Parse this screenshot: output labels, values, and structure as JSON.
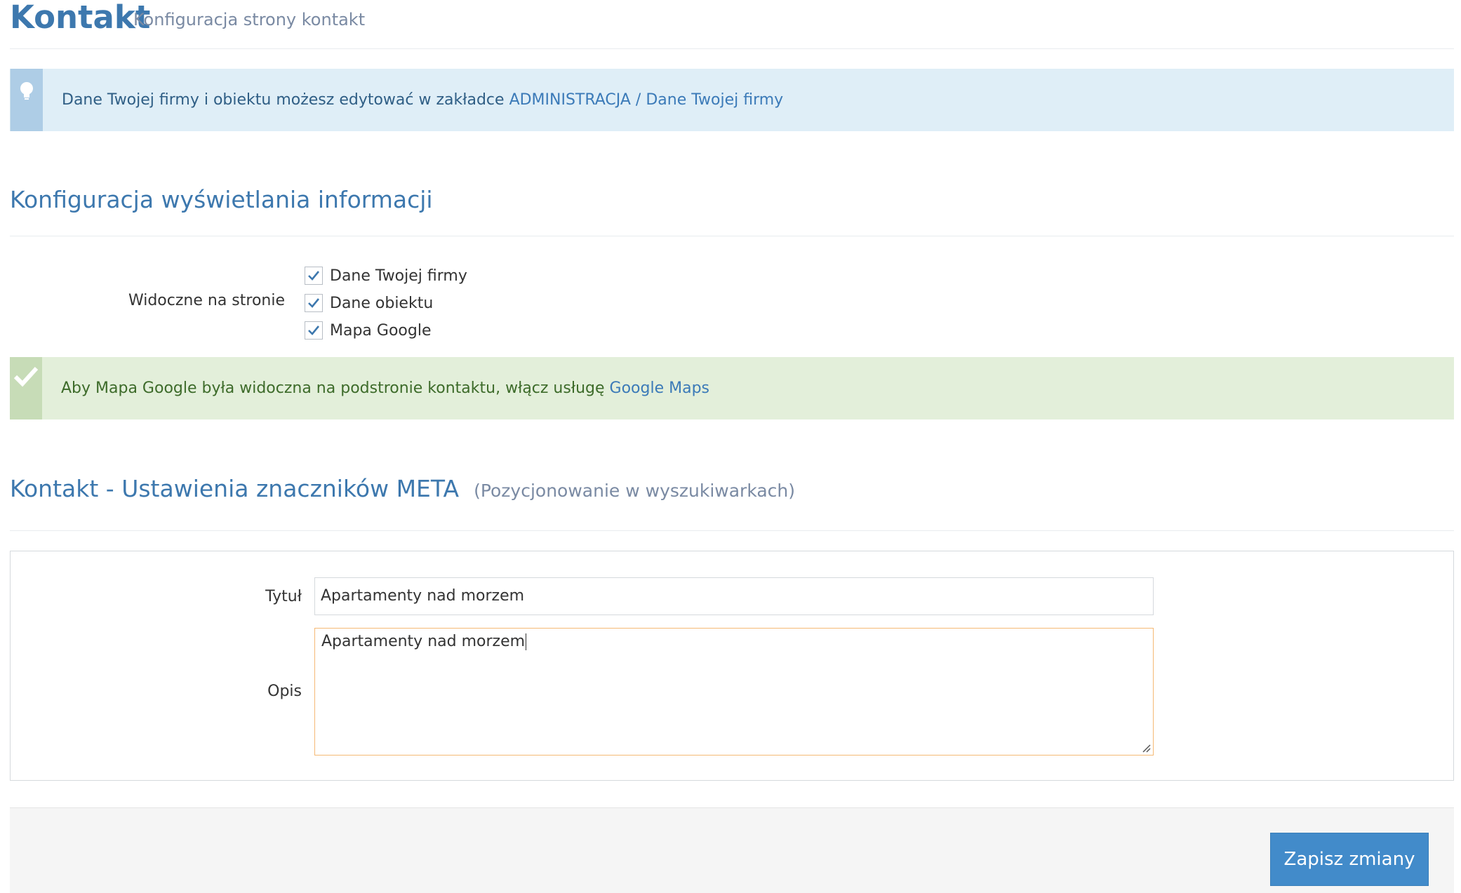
{
  "header": {
    "title": "Kontakt",
    "subtitle": "Konfiguracja strony kontakt"
  },
  "info_alert": {
    "icon": "lightbulb-icon",
    "text": "Dane Twojej firmy i obiektu możesz edytować w zakładce ",
    "link": "ADMINISTRACJA / Dane Twojej firmy"
  },
  "display_section": {
    "title": "Konfiguracja wyświetlania informacji",
    "visible_label": "Widoczne na stronie",
    "options": [
      {
        "label": "Dane Twojej firmy",
        "checked": true
      },
      {
        "label": "Dane obiektu",
        "checked": true
      },
      {
        "label": "Mapa Google",
        "checked": true
      }
    ]
  },
  "success_alert": {
    "icon": "check-icon",
    "text": "Aby Mapa Google była widoczna na podstronie kontaktu, włącz usługę ",
    "link": "Google Maps"
  },
  "meta_section": {
    "title": "Kontakt - Ustawienia znaczników META",
    "subtitle": "(Pozycjonowanie w wyszukiwarkach)",
    "title_label": "Tytuł",
    "title_value": "Apartamenty nad morzem",
    "description_label": "Opis",
    "description_value": "Apartamenty nad morzem"
  },
  "footer": {
    "save_label": "Zapisz zmiany"
  },
  "colors": {
    "accent": "#3d78ae",
    "button": "#428bca",
    "info_bg": "#dfeef7",
    "success_bg": "#e3efda",
    "focus_border": "#f5b975"
  }
}
